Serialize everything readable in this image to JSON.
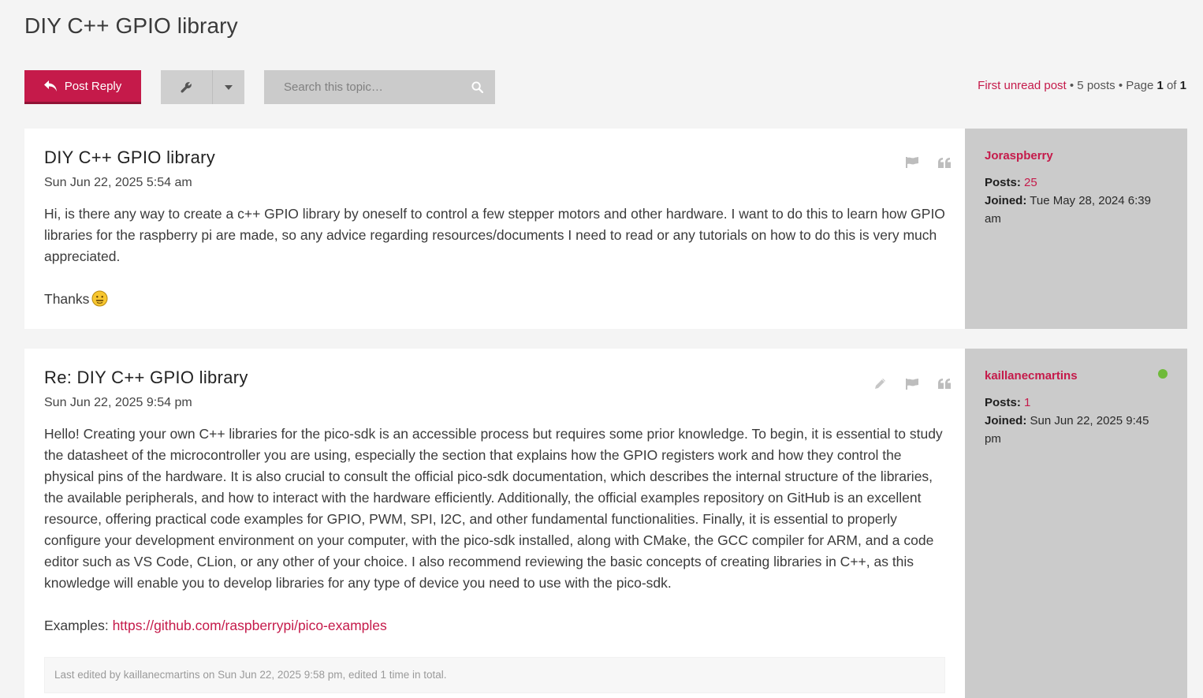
{
  "topic": {
    "title": "DIY C++ GPIO library"
  },
  "action_bar": {
    "reply_label": "Post Reply",
    "search_placeholder": "Search this topic…",
    "pagination": {
      "first_unread": "First unread post",
      "posts_count": " • 5 posts • Page ",
      "page_current": "1",
      "of_text": " of ",
      "page_total": "1"
    }
  },
  "posts": [
    {
      "title": "DIY C++ GPIO library",
      "date": "Sun Jun 22, 2025 5:54 am",
      "content": [
        "Hi, is there any way to create a c++ GPIO library by oneself to control a few stepper motors and other hardware. I want to do this to learn how GPIO libraries for the raspberry pi are made, so any advice regarding resources/documents I need to read or any tutorials on how to do this is very much appreciated.",
        "Thanks"
      ],
      "author": {
        "name": "Joraspberry",
        "posts_label": "Posts:",
        "posts_value": "25",
        "joined_label": "Joined:",
        "joined_value": "Tue May 28, 2024 6:39 am"
      }
    },
    {
      "title": "Re: DIY C++ GPIO library",
      "date": "Sun Jun 22, 2025 9:54 pm",
      "content": [
        "Hello! Creating your own C++ libraries for the pico-sdk is an accessible process but requires some prior knowledge. To begin, it is essential to study the datasheet of the microcontroller you are using, especially the section that explains how the GPIO registers work and how they control the physical pins of the hardware. It is also crucial to consult the official pico-sdk documentation, which describes the internal structure of the libraries, the available peripherals, and how to interact with the hardware efficiently. Additionally, the official examples repository on GitHub is an excellent resource, offering practical code examples for GPIO, PWM, SPI, I2C, and other fundamental functionalities. Finally, it is essential to properly configure your development environment on your computer, with the pico-sdk installed, along with CMake, the GCC compiler for ARM, and a code editor such as VS Code, CLion, or any other of your choice. I also recommend reviewing the basic concepts of creating libraries in C++, as this knowledge will enable you to develop libraries for any type of device you need to use with the pico-sdk."
      ],
      "examples_label": "Examples: ",
      "examples_link": "https://github.com/raspberrypi/pico-examples",
      "edit_notice": "Last edited by kaillanecmartins on Sun Jun 22, 2025 9:58 pm, edited 1 time in total.",
      "author": {
        "name": "kaillanecmartins",
        "posts_label": "Posts:",
        "posts_value": "1",
        "joined_label": "Joined:",
        "joined_value": "Sun Jun 22, 2025 9:45 pm",
        "online": true
      }
    }
  ],
  "colors": {
    "accent": "#c51a4a",
    "profile_bg": "#cbcbcb",
    "online": "#6fba3a"
  },
  "icons": [
    "reply-icon",
    "wrench-icon",
    "caret-down-icon",
    "search-icon",
    "flag-icon",
    "quote-icon",
    "pencil-icon",
    "emoji-icon"
  ]
}
